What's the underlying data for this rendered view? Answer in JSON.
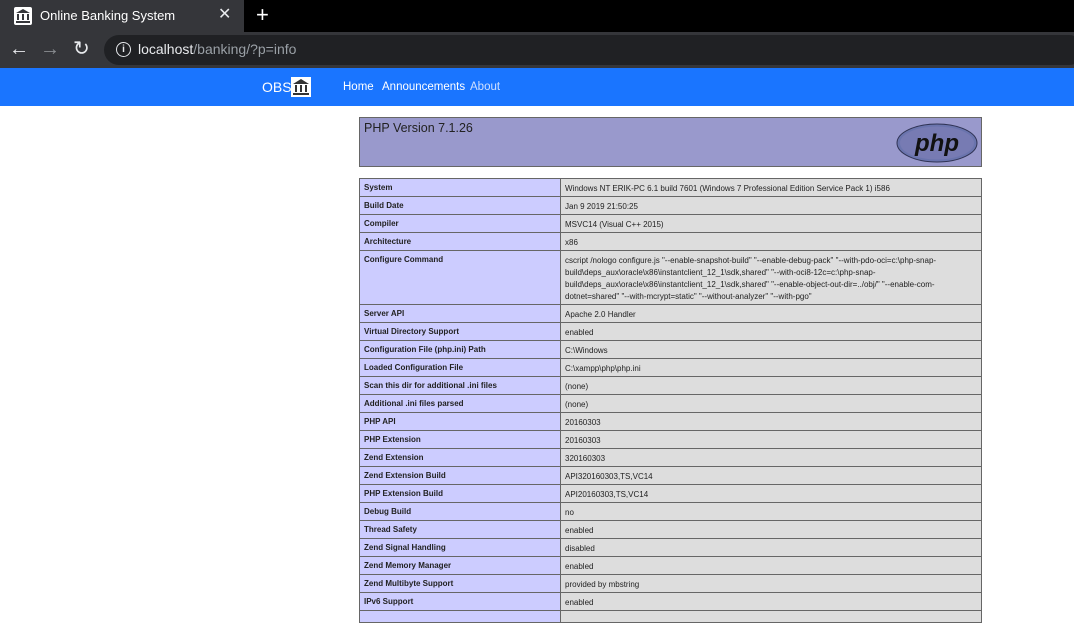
{
  "browser": {
    "tab_title": "Online Banking System",
    "url_host": "localhost",
    "url_path": "/banking/?p=info"
  },
  "site": {
    "brand": "OBS",
    "nav": [
      "Home",
      "Announcements",
      "About"
    ]
  },
  "php": {
    "version": "PHP Version 7.1.26",
    "logo_text": "php",
    "rows": [
      {
        "k": "System",
        "v": "Windows NT ERIK-PC 6.1 build 7601 (Windows 7 Professional Edition Service Pack 1) i586"
      },
      {
        "k": "Build Date",
        "v": "Jan 9 2019 21:50:25"
      },
      {
        "k": "Compiler",
        "v": "MSVC14 (Visual C++ 2015)"
      },
      {
        "k": "Architecture",
        "v": "x86"
      },
      {
        "k": "Configure Command",
        "v": "cscript /nologo configure.js \"--enable-snapshot-build\" \"--enable-debug-pack\" \"--with-pdo-oci=c:\\php-snap-build\\deps_aux\\oracle\\x86\\instantclient_12_1\\sdk,shared\" \"--with-oci8-12c=c:\\php-snap-build\\deps_aux\\oracle\\x86\\instantclient_12_1\\sdk,shared\" \"--enable-object-out-dir=../obj/\" \"--enable-com-dotnet=shared\" \"--with-mcrypt=static\" \"--without-analyzer\" \"--with-pgo\""
      },
      {
        "k": "Server API",
        "v": "Apache 2.0 Handler"
      },
      {
        "k": "Virtual Directory Support",
        "v": "enabled"
      },
      {
        "k": "Configuration File (php.ini) Path",
        "v": "C:\\Windows"
      },
      {
        "k": "Loaded Configuration File",
        "v": "C:\\xampp\\php\\php.ini"
      },
      {
        "k": "Scan this dir for additional .ini files",
        "v": "(none)"
      },
      {
        "k": "Additional .ini files parsed",
        "v": "(none)"
      },
      {
        "k": "PHP API",
        "v": "20160303"
      },
      {
        "k": "PHP Extension",
        "v": "20160303"
      },
      {
        "k": "Zend Extension",
        "v": "320160303"
      },
      {
        "k": "Zend Extension Build",
        "v": "API320160303,TS,VC14"
      },
      {
        "k": "PHP Extension Build",
        "v": "API20160303,TS,VC14"
      },
      {
        "k": "Debug Build",
        "v": "no"
      },
      {
        "k": "Thread Safety",
        "v": "enabled"
      },
      {
        "k": "Zend Signal Handling",
        "v": "disabled"
      },
      {
        "k": "Zend Memory Manager",
        "v": "enabled"
      },
      {
        "k": "Zend Multibyte Support",
        "v": "provided by mbstring"
      },
      {
        "k": "IPv6 Support",
        "v": "enabled"
      },
      {
        "k": "",
        "v": ""
      }
    ]
  }
}
